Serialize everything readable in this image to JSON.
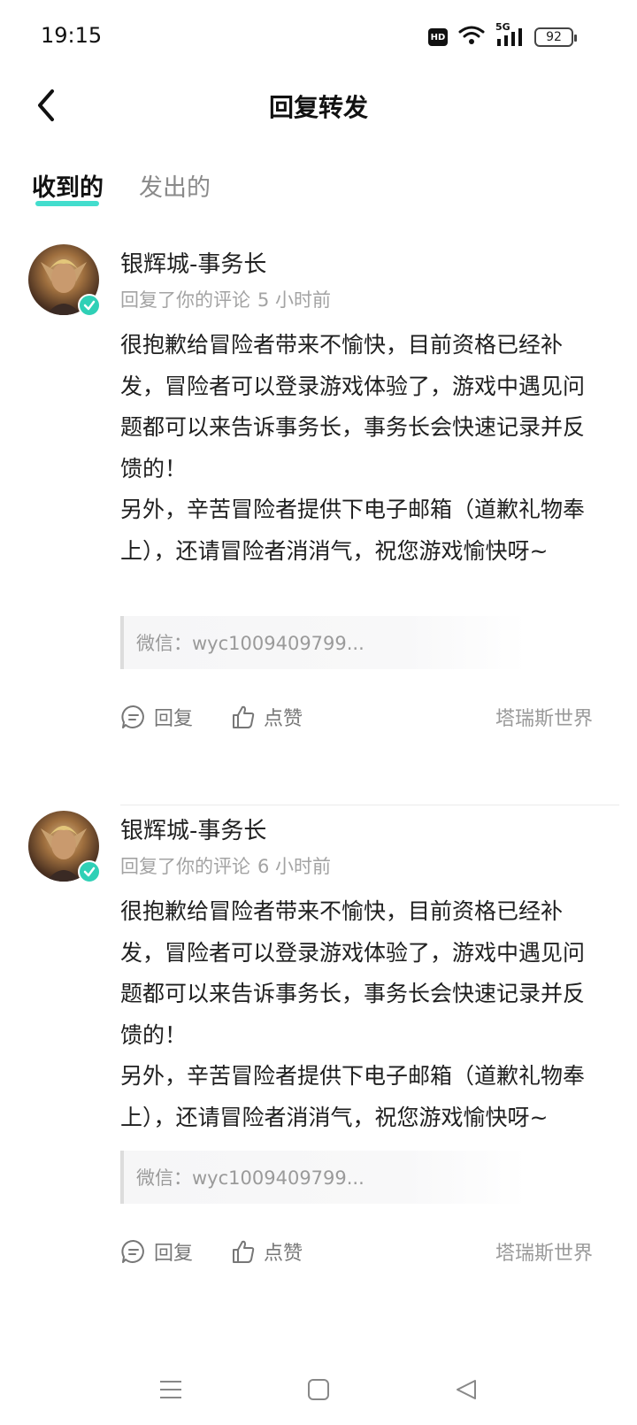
{
  "status_bar": {
    "time": "19:15",
    "hd": "HD",
    "network": "5G",
    "battery": "92"
  },
  "header": {
    "title": "回复转发"
  },
  "tabs": [
    {
      "label": "收到的",
      "active": true
    },
    {
      "label": "发出的",
      "active": false
    }
  ],
  "accent_color": "#2fd9c8",
  "badge_color": "#2fd0b6",
  "items": [
    {
      "author": "银辉城-事务长",
      "action_text": "回复了你的评论",
      "time": "5 小时前",
      "content": "很抱歉给冒险者带来不愉快，目前资格已经补发，冒险者可以登录游戏体验了，游戏中遇见问题都可以来告诉事务长，事务长会快速记录并反馈的！\n另外，辛苦冒险者提供下电子邮箱（道歉礼物奉上），还请冒险者消消气，祝您游戏愉快呀~",
      "quote": "微信：wyc1009409799...",
      "reply_label": "回复",
      "like_label": "点赞",
      "source": "塔瑞斯世界"
    },
    {
      "author": "银辉城-事务长",
      "action_text": "回复了你的评论",
      "time": "6 小时前",
      "content": "很抱歉给冒险者带来不愉快，目前资格已经补发，冒险者可以登录游戏体验了，游戏中遇见问题都可以来告诉事务长，事务长会快速记录并反馈的！\n另外，辛苦冒险者提供下电子邮箱（道歉礼物奉上），还请冒险者消消气，祝您游戏愉快呀~",
      "quote": "微信：wyc1009409799...",
      "reply_label": "回复",
      "like_label": "点赞",
      "source": "塔瑞斯世界"
    }
  ],
  "system_nav": {
    "menu_icon": "menu-icon",
    "home_icon": "home-icon",
    "back_icon": "back-triangle-icon"
  }
}
